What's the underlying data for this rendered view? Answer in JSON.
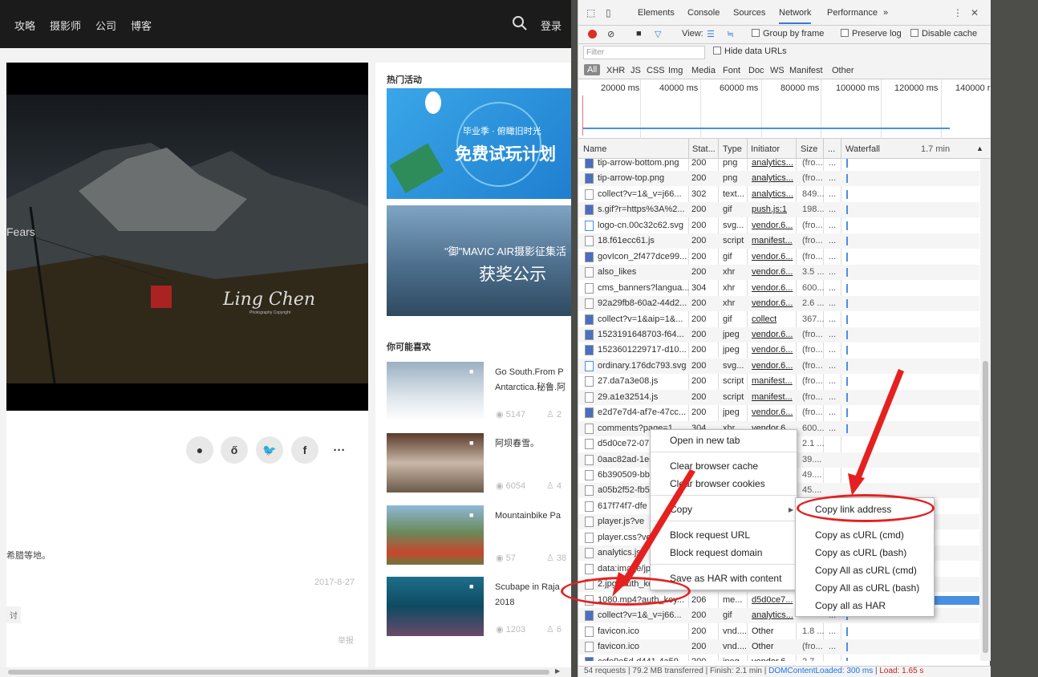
{
  "site": {
    "nav": [
      "攻略",
      "摄影师",
      "公司",
      "博客"
    ],
    "login": "登录",
    "hero_text": "Fears",
    "hero_signature": "Ling Chen",
    "hero_signature_sub": "Photography Copyright",
    "desc_fragment": "希腊等地。",
    "date": "2017-8-27",
    "tag_fragment": "讨",
    "report": "举报",
    "share_icons": [
      "wechat-icon",
      "weibo-icon",
      "twitter-icon",
      "facebook-icon",
      "more-icon"
    ]
  },
  "sidebar": {
    "hot_title": "热门活动",
    "banner1_small": "毕业季 · 俯瞰旧时光",
    "banner1_big": "免费试玩计划",
    "banner2_small": "\"御\"MAVIC AIR摄影征集活",
    "banner2_big": "获奖公示",
    "recommend_title": "你可能喜欢",
    "videos": [
      {
        "title": "Go South.From P",
        "title2": "Antarctica.秘鲁.阿",
        "views": "5147",
        "likes": "2"
      },
      {
        "title": "阿坝春雪。",
        "title2": "",
        "views": "6054",
        "likes": "4"
      },
      {
        "title": "Mountainbike Pa",
        "title2": "",
        "views": "57",
        "likes": "38"
      },
      {
        "title": "Scubape in Raja",
        "title2": "2018",
        "views": "1203",
        "likes": "6"
      }
    ]
  },
  "devtools": {
    "tabs": [
      "Elements",
      "Console",
      "Sources",
      "Network",
      "Performance",
      "»"
    ],
    "active_tab": "Network",
    "toolbar": {
      "view": "View:",
      "group": "Group by frame",
      "preserve": "Preserve log",
      "disable": "Disable cache"
    },
    "filter_placeholder": "Filter",
    "hide_data_urls": "Hide data URLs",
    "types": [
      "All",
      "XHR",
      "JS",
      "CSS",
      "Img",
      "Media",
      "Font",
      "Doc",
      "WS",
      "Manifest",
      "Other"
    ],
    "ticks": [
      "20000 ms",
      "40000 ms",
      "60000 ms",
      "80000 ms",
      "100000 ms",
      "120000 ms",
      "140000 r"
    ],
    "columns": [
      "Name",
      "Stat...",
      "Type",
      "Initiator",
      "Size",
      "...",
      "Waterfall",
      "1.7 min"
    ],
    "rows": [
      {
        "name": "tip-arrow-bottom.png",
        "status": "200",
        "type": "png",
        "initiator": "analytics...",
        "size": "(fro..."
      },
      {
        "name": "tip-arrow-top.png",
        "status": "200",
        "type": "png",
        "initiator": "analytics...",
        "size": "(fro..."
      },
      {
        "name": "collect?v=1&_v=j66...",
        "status": "302",
        "type": "text...",
        "initiator": "analytics...",
        "size": "849..."
      },
      {
        "name": "s.gif?r=https%3A%2...",
        "status": "200",
        "type": "gif",
        "initiator": "push.js:1",
        "size": "198..."
      },
      {
        "name": "logo-cn.00c32c62.svg",
        "status": "200",
        "type": "svg...",
        "initiator": "vendor.6...",
        "size": "(fro..."
      },
      {
        "name": "18.f61ecc61.js",
        "status": "200",
        "type": "script",
        "initiator": "manifest...",
        "size": "(fro..."
      },
      {
        "name": "govIcon_2f477dce99...",
        "status": "200",
        "type": "gif",
        "initiator": "vendor.6...",
        "size": "(fro..."
      },
      {
        "name": "also_likes",
        "status": "200",
        "type": "xhr",
        "initiator": "vendor.6...",
        "size": "3.5 ..."
      },
      {
        "name": "cms_banners?langua...",
        "status": "304",
        "type": "xhr",
        "initiator": "vendor.6...",
        "size": "600..."
      },
      {
        "name": "92a29fb8-60a2-44d2...",
        "status": "200",
        "type": "xhr",
        "initiator": "vendor.6...",
        "size": "2.6 ..."
      },
      {
        "name": "collect?v=1&aip=1&...",
        "status": "200",
        "type": "gif",
        "initiator": "collect",
        "size": "367..."
      },
      {
        "name": "1523191648703-f64...",
        "status": "200",
        "type": "jpeg",
        "initiator": "vendor.6...",
        "size": "(fro..."
      },
      {
        "name": "1523601229717-d10...",
        "status": "200",
        "type": "jpeg",
        "initiator": "vendor.6...",
        "size": "(fro..."
      },
      {
        "name": "ordinary.176dc793.svg",
        "status": "200",
        "type": "svg...",
        "initiator": "vendor.6...",
        "size": "(fro..."
      },
      {
        "name": "27.da7a3e08.js",
        "status": "200",
        "type": "script",
        "initiator": "manifest...",
        "size": "(fro..."
      },
      {
        "name": "29.a1e32514.js",
        "status": "200",
        "type": "script",
        "initiator": "manifest...",
        "size": "(fro..."
      },
      {
        "name": "e2d7e7d4-af7e-47cc...",
        "status": "200",
        "type": "jpeg",
        "initiator": "vendor.6...",
        "size": "(fro..."
      },
      {
        "name": "comments?page=1...",
        "status": "304",
        "type": "xhr",
        "initiator": "vendor.6...",
        "size": "600..."
      },
      {
        "name": "d5d0ce72-07:",
        "status": "",
        "type": "",
        "initiator": "",
        "size": "2.1 ..."
      },
      {
        "name": "0aac82ad-1e6",
        "status": "",
        "type": "",
        "initiator": "",
        "size": "39...."
      },
      {
        "name": "6b390509-bb",
        "status": "",
        "type": "",
        "initiator": "",
        "size": "49...."
      },
      {
        "name": "a05b2f52-fb5",
        "status": "",
        "type": "",
        "initiator": "",
        "size": "45...."
      },
      {
        "name": "617f74f7-dfe",
        "status": "",
        "type": "",
        "initiator": "",
        "size": ""
      },
      {
        "name": "player.js?ve",
        "status": "",
        "type": "",
        "initiator": "",
        "size": ""
      },
      {
        "name": "player.css?ver",
        "status": "",
        "type": "",
        "initiator": "",
        "size": ""
      },
      {
        "name": "analytics.js",
        "status": "",
        "type": "",
        "initiator": "",
        "size": ""
      },
      {
        "name": "data:image/jp",
        "status": "",
        "type": "",
        "initiator": "",
        "size": ""
      },
      {
        "name": "2.jpg?auth_ke",
        "status": "",
        "type": "",
        "initiator": "",
        "size": ""
      },
      {
        "name": "1080.mp4?auth_key...",
        "status": "206",
        "type": "me...",
        "initiator": "d5d0ce7...",
        "size": ""
      },
      {
        "name": "collect?v=1&_v=j66...",
        "status": "200",
        "type": "gif",
        "initiator": "analytics...",
        "size": ""
      },
      {
        "name": "favicon.ico",
        "status": "200",
        "type": "vnd....",
        "initiator": "Other",
        "size": "1.8 ..."
      },
      {
        "name": "favicon.ico",
        "status": "200",
        "type": "vnd....",
        "initiator": "Other",
        "size": "(fro..."
      },
      {
        "name": "ccfe9e5d-d441-4a59...",
        "status": "200",
        "type": "jpeg",
        "initiator": "vendor.6...",
        "size": "2.7 ..."
      }
    ],
    "status": {
      "requests": "54 requests",
      "transferred": "79.2 MB transferred",
      "finish": "Finish: 2.1 min",
      "dcl": "DOMContentLoaded: 300 ms",
      "load": "Load: 1.65 s"
    }
  },
  "context_menu": {
    "items": [
      "Open in new tab",
      "Clear browser cache",
      "Clear browser cookies",
      "Copy",
      "Block request URL",
      "Block request domain",
      "Save as HAR with content"
    ]
  },
  "copy_submenu": {
    "items": [
      "Copy link address",
      "Copy as cURL (cmd)",
      "Copy as cURL (bash)",
      "Copy All as cURL (cmd)",
      "Copy All as cURL (bash)",
      "Copy all as HAR"
    ]
  },
  "colors": {
    "annotation": "#e52020",
    "accent": "#3879d9"
  }
}
